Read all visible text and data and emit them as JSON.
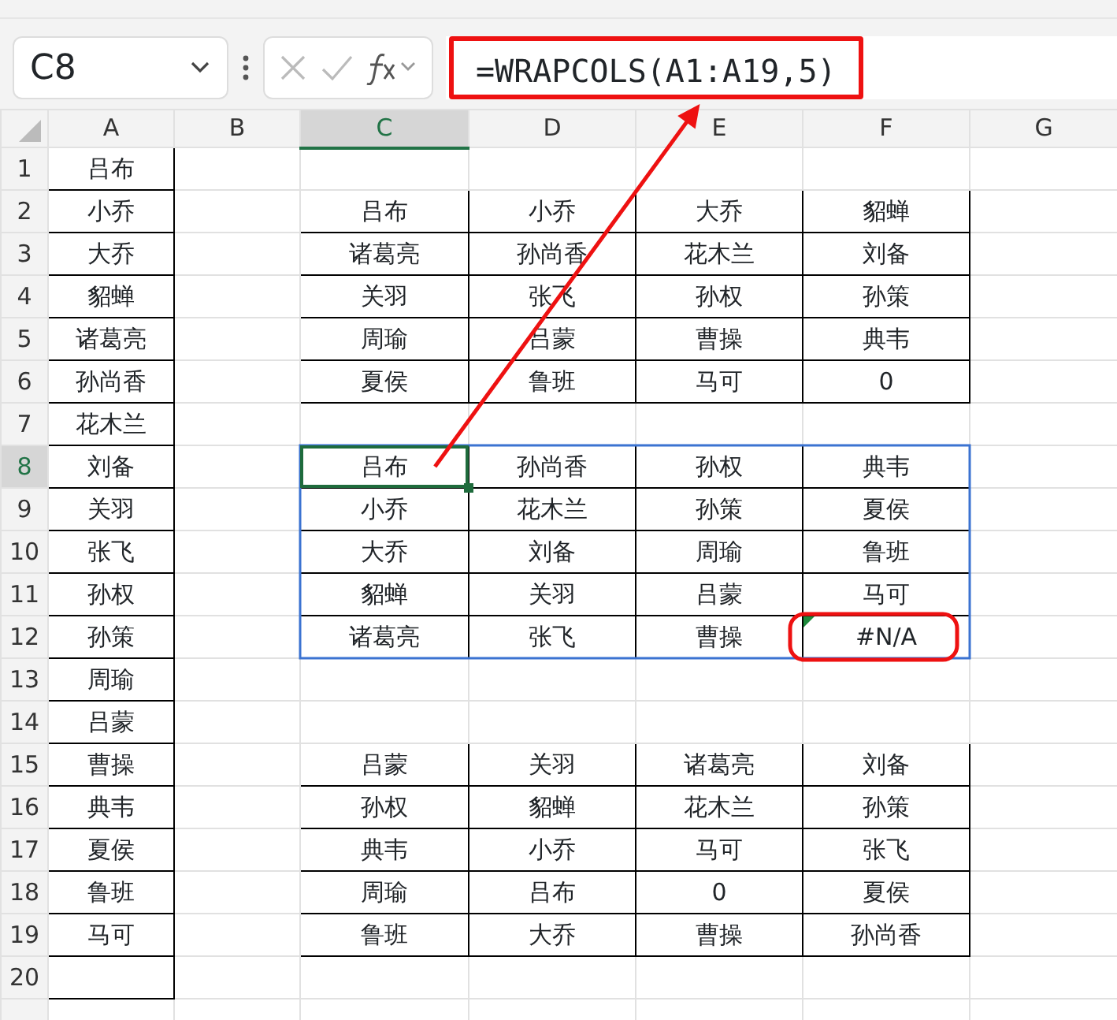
{
  "formula_bar": {
    "name_box": "C8",
    "formula": "=WRAPCOLS(A1:A19,5)",
    "circled": true
  },
  "annotation_arrow": true,
  "column_headers": [
    {
      "label": "A",
      "selected": false
    },
    {
      "label": "B",
      "selected": false
    },
    {
      "label": "C",
      "selected": true
    },
    {
      "label": "D",
      "selected": false
    },
    {
      "label": "E",
      "selected": false
    },
    {
      "label": "F",
      "selected": false
    },
    {
      "label": "G",
      "selected": false
    }
  ],
  "rows": [
    {
      "number": "1",
      "selected": false,
      "cells": [
        {
          "text": "吕布",
          "bordered": true
        },
        {},
        {},
        {},
        {},
        {},
        {}
      ]
    },
    {
      "number": "2",
      "selected": false,
      "cells": [
        {
          "text": "小乔",
          "bordered": true
        },
        {},
        {
          "text": "吕布",
          "bordered": true
        },
        {
          "text": "小乔",
          "bordered": true
        },
        {
          "text": "大乔",
          "bordered": true
        },
        {
          "text": "貂蝉",
          "bordered": true
        },
        {}
      ]
    },
    {
      "number": "3",
      "selected": false,
      "cells": [
        {
          "text": "大乔",
          "bordered": true
        },
        {},
        {
          "text": "诸葛亮",
          "bordered": true
        },
        {
          "text": "孙尚香",
          "bordered": true
        },
        {
          "text": "花木兰",
          "bordered": true
        },
        {
          "text": "刘备",
          "bordered": true
        },
        {}
      ]
    },
    {
      "number": "4",
      "selected": false,
      "cells": [
        {
          "text": "貂蝉",
          "bordered": true
        },
        {},
        {
          "text": "关羽",
          "bordered": true
        },
        {
          "text": "张飞",
          "bordered": true
        },
        {
          "text": "孙权",
          "bordered": true
        },
        {
          "text": "孙策",
          "bordered": true
        },
        {}
      ]
    },
    {
      "number": "5",
      "selected": false,
      "cells": [
        {
          "text": "诸葛亮",
          "bordered": true
        },
        {},
        {
          "text": "周瑜",
          "bordered": true
        },
        {
          "text": "吕蒙",
          "bordered": true
        },
        {
          "text": "曹操",
          "bordered": true
        },
        {
          "text": "典韦",
          "bordered": true
        },
        {}
      ]
    },
    {
      "number": "6",
      "selected": false,
      "cells": [
        {
          "text": "孙尚香",
          "bordered": true
        },
        {},
        {
          "text": "夏侯",
          "bordered": true
        },
        {
          "text": "鲁班",
          "bordered": true
        },
        {
          "text": "马可",
          "bordered": true
        },
        {
          "text": "0",
          "bordered": true
        },
        {}
      ]
    },
    {
      "number": "7",
      "selected": false,
      "cells": [
        {
          "text": "花木兰",
          "bordered": true
        },
        {},
        {},
        {},
        {},
        {},
        {}
      ]
    },
    {
      "number": "8",
      "selected": true,
      "cells": [
        {
          "text": "刘备",
          "bordered": true
        },
        {},
        {
          "text": "吕布",
          "bordered": true,
          "spill": true,
          "active": true
        },
        {
          "text": "孙尚香",
          "bordered": true,
          "spill": true
        },
        {
          "text": "孙权",
          "bordered": true,
          "spill": true
        },
        {
          "text": "典韦",
          "bordered": true,
          "spill": true
        },
        {}
      ]
    },
    {
      "number": "9",
      "selected": false,
      "cells": [
        {
          "text": "关羽",
          "bordered": true
        },
        {},
        {
          "text": "小乔",
          "bordered": true,
          "spill": true
        },
        {
          "text": "花木兰",
          "bordered": true,
          "spill": true
        },
        {
          "text": "孙策",
          "bordered": true,
          "spill": true
        },
        {
          "text": "夏侯",
          "bordered": true,
          "spill": true
        },
        {}
      ]
    },
    {
      "number": "10",
      "selected": false,
      "cells": [
        {
          "text": "张飞",
          "bordered": true
        },
        {},
        {
          "text": "大乔",
          "bordered": true,
          "spill": true
        },
        {
          "text": "刘备",
          "bordered": true,
          "spill": true
        },
        {
          "text": "周瑜",
          "bordered": true,
          "spill": true
        },
        {
          "text": "鲁班",
          "bordered": true,
          "spill": true
        },
        {}
      ]
    },
    {
      "number": "11",
      "selected": false,
      "cells": [
        {
          "text": "孙权",
          "bordered": true
        },
        {},
        {
          "text": "貂蝉",
          "bordered": true,
          "spill": true
        },
        {
          "text": "关羽",
          "bordered": true,
          "spill": true
        },
        {
          "text": "吕蒙",
          "bordered": true,
          "spill": true
        },
        {
          "text": "马可",
          "bordered": true,
          "spill": true
        },
        {}
      ]
    },
    {
      "number": "12",
      "selected": false,
      "cells": [
        {
          "text": "孙策",
          "bordered": true
        },
        {},
        {
          "text": "诸葛亮",
          "bordered": true,
          "spill": true
        },
        {
          "text": "张飞",
          "bordered": true,
          "spill": true
        },
        {
          "text": "曹操",
          "bordered": true,
          "spill": true
        },
        {
          "text": "#N/A",
          "bordered": true,
          "spill": true,
          "error": true,
          "circled": true
        },
        {}
      ]
    },
    {
      "number": "13",
      "selected": false,
      "cells": [
        {
          "text": "周瑜",
          "bordered": true
        },
        {},
        {},
        {},
        {},
        {},
        {}
      ]
    },
    {
      "number": "14",
      "selected": false,
      "cells": [
        {
          "text": "吕蒙",
          "bordered": true
        },
        {},
        {},
        {},
        {},
        {},
        {}
      ]
    },
    {
      "number": "15",
      "selected": false,
      "cells": [
        {
          "text": "曹操",
          "bordered": true
        },
        {},
        {
          "text": "吕蒙",
          "bordered": true
        },
        {
          "text": "关羽",
          "bordered": true
        },
        {
          "text": "诸葛亮",
          "bordered": true
        },
        {
          "text": "刘备",
          "bordered": true
        },
        {}
      ]
    },
    {
      "number": "16",
      "selected": false,
      "cells": [
        {
          "text": "典韦",
          "bordered": true
        },
        {},
        {
          "text": "孙权",
          "bordered": true
        },
        {
          "text": "貂蝉",
          "bordered": true
        },
        {
          "text": "花木兰",
          "bordered": true
        },
        {
          "text": "孙策",
          "bordered": true
        },
        {}
      ]
    },
    {
      "number": "17",
      "selected": false,
      "cells": [
        {
          "text": "夏侯",
          "bordered": true
        },
        {},
        {
          "text": "典韦",
          "bordered": true
        },
        {
          "text": "小乔",
          "bordered": true
        },
        {
          "text": "马可",
          "bordered": true
        },
        {
          "text": "张飞",
          "bordered": true
        },
        {}
      ]
    },
    {
      "number": "18",
      "selected": false,
      "cells": [
        {
          "text": "鲁班",
          "bordered": true
        },
        {},
        {
          "text": "周瑜",
          "bordered": true
        },
        {
          "text": "吕布",
          "bordered": true
        },
        {
          "text": "0",
          "bordered": true
        },
        {
          "text": "夏侯",
          "bordered": true
        },
        {}
      ]
    },
    {
      "number": "19",
      "selected": false,
      "cells": [
        {
          "text": "马可",
          "bordered": true
        },
        {},
        {
          "text": "鲁班",
          "bordered": true
        },
        {
          "text": "大乔",
          "bordered": true
        },
        {
          "text": "曹操",
          "bordered": true
        },
        {
          "text": "孙尚香",
          "bordered": true
        },
        {}
      ]
    },
    {
      "number": "20",
      "selected": false,
      "cells": [
        {
          "bordered": true
        },
        {},
        {},
        {},
        {},
        {},
        {}
      ]
    },
    {
      "selected": false,
      "cells": [
        {},
        {},
        {},
        {},
        {},
        {},
        {}
      ]
    }
  ]
}
